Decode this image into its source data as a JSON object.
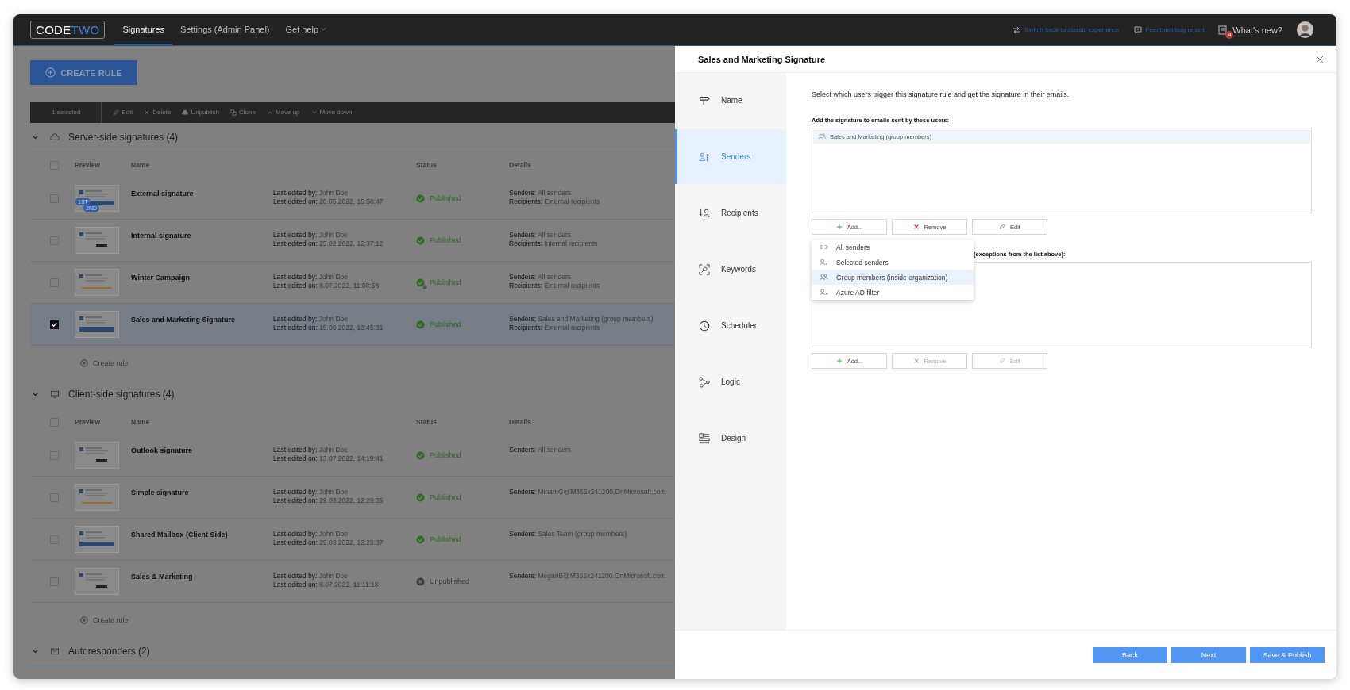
{
  "header": {
    "logo": [
      {
        "text": "CODE",
        "color": "#ffffff"
      },
      {
        "text": "TWO",
        "color": "#3b82d6"
      }
    ],
    "nav": [
      {
        "label": "Signatures",
        "selected": true,
        "menu": false
      },
      {
        "label": "Settings (Admin Panel)",
        "selected": false,
        "menu": false
      },
      {
        "label": "Get help",
        "selected": false,
        "menu": true
      }
    ],
    "links": [
      {
        "label": "Switch back to classic experience",
        "kind": "switch"
      },
      {
        "label": "Feedback/bug report",
        "kind": "feedback"
      }
    ],
    "whats_new": {
      "label": "What's new?",
      "badge": "4"
    }
  },
  "create_button": "CREATE RULE",
  "toolbar": {
    "selection": "1 selected",
    "actions": [
      {
        "label": "Edit",
        "kind": "edit"
      },
      {
        "label": "Delete",
        "kind": "delete"
      },
      {
        "label": "Unpublish",
        "kind": "unpublish"
      },
      {
        "label": "Clone",
        "kind": "clone"
      },
      {
        "label": "Move up",
        "kind": "up"
      },
      {
        "label": "Move down",
        "kind": "down"
      }
    ]
  },
  "sections": [
    {
      "title": "Server-side signatures (4)",
      "kind": "server",
      "all_checked": false,
      "columns": [
        "Preview",
        "Name",
        "Status",
        "Details"
      ],
      "create_label": "Create rule",
      "rows": [
        {
          "name": "External signature",
          "selected": false,
          "badges": [
            "1ST",
            "2ND"
          ],
          "edited_by_label": "Last edited by:",
          "edited_by": "John Doe",
          "edited_on_label": "Last edited on:",
          "edited_on": "20.05.2022, 15:58:47",
          "status": "Published",
          "kind": "published",
          "scheduled": false,
          "details": [
            {
              "label": "Senders:",
              "value": "All senders"
            },
            {
              "label": "Recipients:",
              "value": "External recipients"
            }
          ]
        },
        {
          "name": "Internal signature",
          "selected": false,
          "edited_by_label": "Last edited by:",
          "edited_by": "John Doe",
          "edited_on_label": "Last edited on:",
          "edited_on": "25.02.2022, 12:37:12",
          "status": "Published",
          "kind": "published",
          "scheduled": false,
          "details": [
            {
              "label": "Senders:",
              "value": "All senders"
            },
            {
              "label": "Recipients:",
              "value": "Internal recipients"
            }
          ]
        },
        {
          "name": "Winter Campaign",
          "selected": false,
          "edited_by_label": "Last edited by:",
          "edited_by": "John Doe",
          "edited_on_label": "Last edited on:",
          "edited_on": "8.07.2022, 11:08:58",
          "status": "Published",
          "kind": "published",
          "scheduled": true,
          "details": [
            {
              "label": "Senders:",
              "value": "All senders"
            },
            {
              "label": "Recipients:",
              "value": "External recipients"
            }
          ]
        },
        {
          "name": "Sales and Marketing Signature",
          "selected": true,
          "edited_by_label": "Last edited by:",
          "edited_by": "John Doe",
          "edited_on_label": "Last edited on:",
          "edited_on": "15.09.2022, 13:45:31",
          "status": "Published",
          "kind": "published",
          "scheduled": false,
          "details": [
            {
              "label": "Senders:",
              "value": "Sales and Marketing (group members)"
            },
            {
              "label": "Recipients:",
              "value": "External recipients"
            }
          ]
        }
      ]
    },
    {
      "title": "Client-side signatures (4)",
      "kind": "client",
      "all_checked": false,
      "columns": [
        "Preview",
        "Name",
        "Status",
        "Details"
      ],
      "create_label": "Create rule",
      "rows": [
        {
          "name": "Outlook signature",
          "selected": false,
          "edited_by_label": "Last edited by:",
          "edited_by": "John Doe",
          "edited_on_label": "Last edited on:",
          "edited_on": "13.07.2022, 14:19:41",
          "status": "Published",
          "kind": "published",
          "scheduled": false,
          "details": [
            {
              "label": "Senders:",
              "value": "All senders"
            }
          ]
        },
        {
          "name": "Simple signature",
          "selected": false,
          "edited_by_label": "Last edited by:",
          "edited_by": "John Doe",
          "edited_on_label": "Last edited on:",
          "edited_on": "29.03.2022, 12:29:35",
          "status": "Published",
          "kind": "published",
          "scheduled": false,
          "details": [
            {
              "label": "Senders:",
              "value": "MiriamG@M365x241200.OnMicrosoft.com"
            }
          ]
        },
        {
          "name": "Shared Mailbox (Client Side)",
          "selected": false,
          "edited_by_label": "Last edited by:",
          "edited_by": "John Doe",
          "edited_on_label": "Last edited on:",
          "edited_on": "29.03.2022, 12:29:37",
          "status": "Published",
          "kind": "published",
          "scheduled": false,
          "details": [
            {
              "label": "Senders:",
              "value": "Sales Team (group members)"
            }
          ]
        },
        {
          "name": "Sales & Marketing",
          "selected": false,
          "edited_by_label": "Last edited by:",
          "edited_by": "John Doe",
          "edited_on_label": "Last edited on:",
          "edited_on": "8.07.2022, 11:11:18",
          "status": "Unpublished",
          "kind": "unpublished",
          "scheduled": false,
          "details": [
            {
              "label": "Senders:",
              "value": "MeganB@M365x241200.OnMicrosoft.com"
            }
          ]
        }
      ]
    },
    {
      "title": "Autoresponders (2)",
      "kind": "auto"
    }
  ],
  "panel": {
    "title": "Sales and Marketing Signature",
    "nav": [
      {
        "label": "Name",
        "selected": false
      },
      {
        "label": "Senders",
        "selected": true
      },
      {
        "label": "Recipients",
        "selected": false
      },
      {
        "label": "Keywords",
        "selected": false
      },
      {
        "label": "Scheduler",
        "selected": false
      },
      {
        "label": "Logic",
        "selected": false
      },
      {
        "label": "Design",
        "selected": false
      }
    ],
    "intro": "Select which users trigger this signature rule and get the signature in their emails.",
    "include": {
      "label": "Add the signature to emails sent by these users:",
      "items": [
        {
          "text": "Sales and Marketing (group members)",
          "selected": true
        }
      ],
      "buttons": [
        {
          "label": "Add...",
          "kind": "add",
          "disabled": false
        },
        {
          "label": "Remove",
          "kind": "remove",
          "disabled": false
        },
        {
          "label": "Edit",
          "kind": "edit",
          "disabled": false
        }
      ]
    },
    "dropdown": [
      {
        "label": "All senders",
        "selected": false
      },
      {
        "label": "Selected senders",
        "selected": false
      },
      {
        "label": "Group members (inside organization)",
        "selected": true
      },
      {
        "label": "Azure AD filter",
        "selected": false
      }
    ],
    "exclude": {
      "label": "(exceptions from the list above):",
      "buttons": [
        {
          "label": "Add...",
          "kind": "add",
          "disabled": false
        },
        {
          "label": "Remove",
          "kind": "remove",
          "disabled": true
        },
        {
          "label": "Edit",
          "kind": "edit",
          "disabled": true
        }
      ]
    },
    "footer_buttons": [
      "Back",
      "Next",
      "Save & Publish"
    ]
  }
}
